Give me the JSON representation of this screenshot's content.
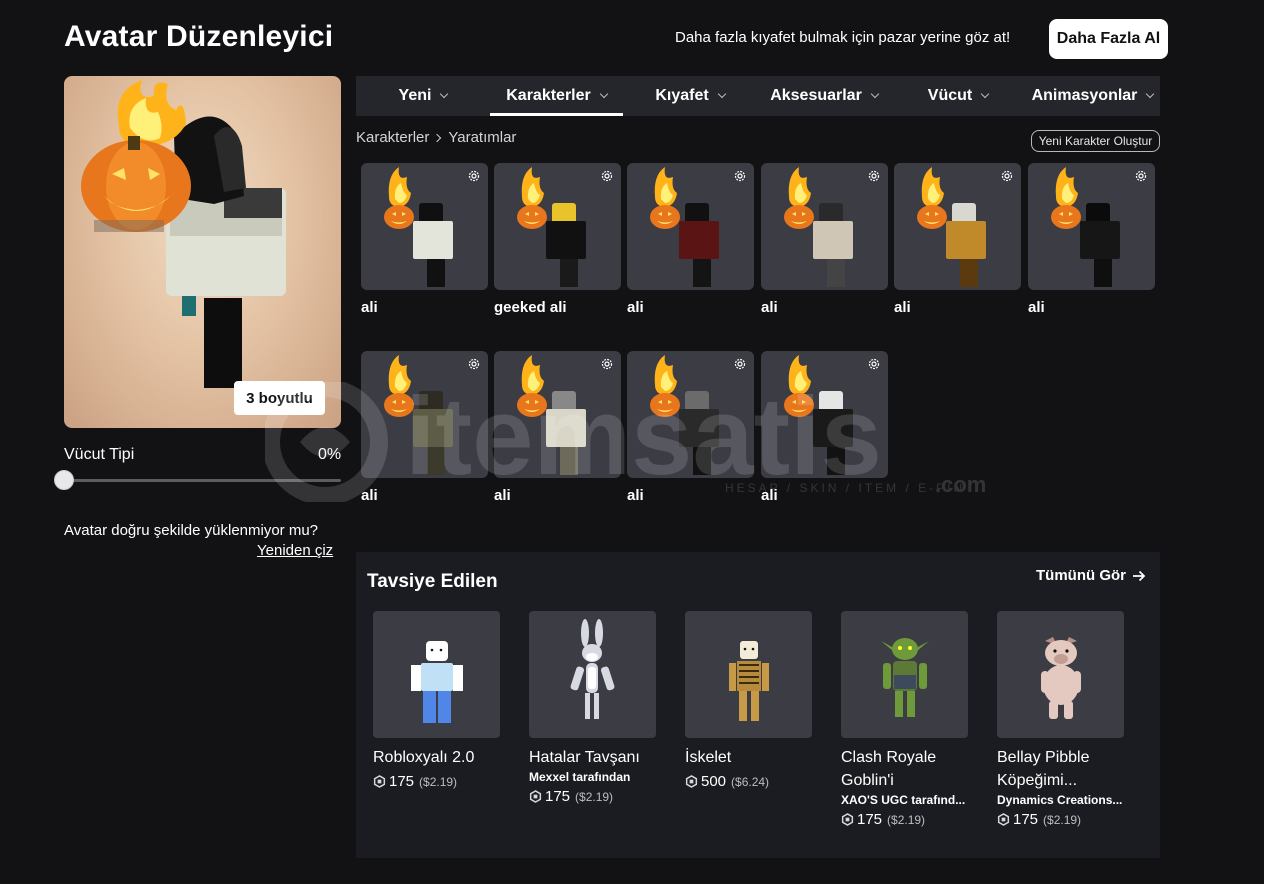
{
  "header": {
    "title": "Avatar Düzenleyici",
    "promo_text": "Daha fazla kıyafet bulmak için pazar yerine göz at!",
    "get_more_label": "Daha Fazla Al"
  },
  "preview": {
    "view_toggle_label": "3 boyutlu",
    "body_type_label": "Vücut Tipi",
    "body_type_value": "0%",
    "body_type_level": 0,
    "render_issue_text": "Avatar doğru şekilde yüklenmiyor mu?",
    "redraw_label": "Yeniden çiz"
  },
  "tabs": [
    {
      "label": "Yeni",
      "active": false
    },
    {
      "label": "Karakterler",
      "active": true
    },
    {
      "label": "Kıyafet",
      "active": false
    },
    {
      "label": "Aksesuarlar",
      "active": false
    },
    {
      "label": "Vücut",
      "active": false
    },
    {
      "label": "Animasyonlar",
      "active": false
    }
  ],
  "breadcrumb": [
    "Karakterler",
    "Yaratımlar"
  ],
  "new_character_label": "Yeni Karakter Oluştur",
  "characters": [
    {
      "name": "ali",
      "outfit": "white-shirt"
    },
    {
      "name": "geeked ali",
      "outfit": "black-yellow"
    },
    {
      "name": "ali",
      "outfit": "red-black"
    },
    {
      "name": "ali",
      "outfit": "patterned"
    },
    {
      "name": "ali",
      "outfit": "leopard"
    },
    {
      "name": "ali",
      "outfit": "all-black"
    },
    {
      "name": "ali",
      "outfit": "camo"
    },
    {
      "name": "ali",
      "outfit": "skeleton-mask"
    },
    {
      "name": "ali",
      "outfit": "dark-hood"
    },
    {
      "name": "ali",
      "outfit": "black-white"
    }
  ],
  "recommended": {
    "title": "Tavsiye Edilen",
    "see_all_label": "Tümünü Gör",
    "items": [
      {
        "name": "Robloxyalı 2.0",
        "creator": "",
        "price": "175",
        "usd": "($2.19)"
      },
      {
        "name": "Hatalar Tavşanı",
        "creator": "Mexxel tarafından",
        "price": "175",
        "usd": "($2.19)"
      },
      {
        "name": "İskelet",
        "creator": "",
        "price": "500",
        "usd": "($6.24)"
      },
      {
        "name": "Clash Royale Goblin'i",
        "creator": "XAO'S UGC tarafınd...",
        "price": "175",
        "usd": "($2.19)"
      },
      {
        "name": "Bellay Pibble Köpeğimi...",
        "creator": "Dynamics Creations...",
        "price": "175",
        "usd": "($2.19)"
      }
    ]
  },
  "watermark": {
    "brand": "itemsatis",
    "tagline": "HESAP / SKIN / ITEM / E-PIN",
    "suffix": ".com"
  },
  "colors": {
    "background": "#121215",
    "panel": "#1b1c21",
    "tab_bar": "#25262b",
    "card": "#3b3c44",
    "pumpkin": "#e8761c",
    "flame": "#ffc21a"
  },
  "icons": [
    "chevron-down-icon",
    "chevron-right-icon",
    "gear-icon",
    "arrow-right-icon",
    "robux-icon"
  ]
}
